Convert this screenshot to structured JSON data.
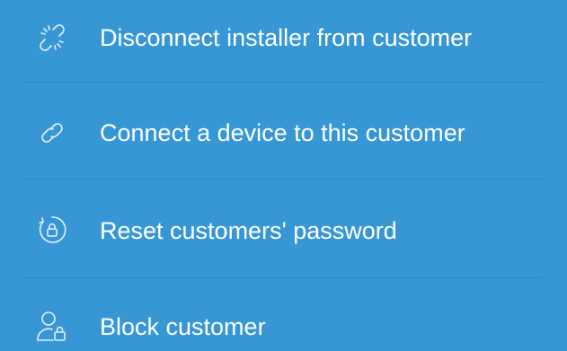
{
  "menu": {
    "items": [
      {
        "label": "Disconnect installer from customer",
        "icon": "broken-link-icon"
      },
      {
        "label": "Connect a device to this customer",
        "icon": "link-icon"
      },
      {
        "label": "Reset customers' password",
        "icon": "lock-reset-icon"
      },
      {
        "label": "Block customer",
        "icon": "user-lock-icon"
      }
    ]
  },
  "colors": {
    "background": "#3797D5",
    "text": "#FFFFFF",
    "icon": "#E6F1FA",
    "divider": "#2C87C4"
  }
}
